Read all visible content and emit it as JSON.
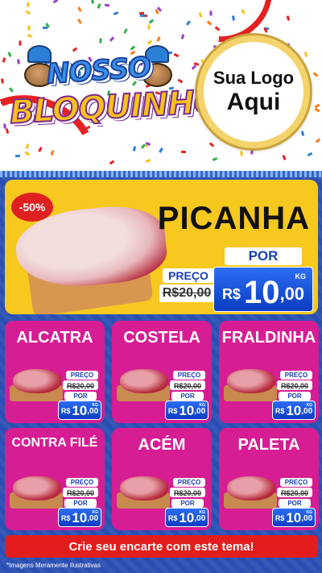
{
  "header": {
    "title_line1": "NOSSO",
    "title_line2": "BLOQUINHO",
    "logo_line1": "Sua Logo",
    "logo_line2": "Aqui"
  },
  "featured": {
    "name": "PICANHA",
    "discount": "-50%",
    "preco_label": "PREÇO",
    "old_price": "R$20,00",
    "por_label": "POR",
    "currency": "R$",
    "price_int": "10",
    "price_dec": ",00",
    "unit": "KG"
  },
  "products": [
    {
      "name": "ALCATRA",
      "preco_label": "PREÇO",
      "old_price": "R$20,00",
      "por_label": "POR",
      "currency": "R$",
      "price_int": "10",
      "price_dec": ",00",
      "unit": "KG"
    },
    {
      "name": "COSTELA",
      "preco_label": "PREÇO",
      "old_price": "R$20,00",
      "por_label": "POR",
      "currency": "R$",
      "price_int": "10",
      "price_dec": ",00",
      "unit": "KG"
    },
    {
      "name": "FRALDINHA",
      "preco_label": "PREÇO",
      "old_price": "R$20,00",
      "por_label": "POR",
      "currency": "R$",
      "price_int": "10",
      "price_dec": ",00",
      "unit": "KG"
    },
    {
      "name": "CONTRA FILÉ",
      "preco_label": "PREÇO",
      "old_price": "R$20,00",
      "por_label": "POR",
      "currency": "R$",
      "price_int": "10",
      "price_dec": ",00",
      "unit": "KG"
    },
    {
      "name": "ACÉM",
      "preco_label": "PREÇO",
      "old_price": "R$20,00",
      "por_label": "POR",
      "currency": "R$",
      "price_int": "10",
      "price_dec": ",00",
      "unit": "KG"
    },
    {
      "name": "PALETA",
      "preco_label": "PREÇO",
      "old_price": "R$20,00",
      "por_label": "POR",
      "currency": "R$",
      "price_int": "10",
      "price_dec": ",00",
      "unit": "KG"
    }
  ],
  "cta": "Crie seu encarte com este tema!",
  "footnote": "*Imagens Meramente Ilustrativas",
  "colors": {
    "card": "#d61d93",
    "feature": "#f7c81e",
    "background": "#2a4fb3",
    "cta": "#e31d1d"
  }
}
